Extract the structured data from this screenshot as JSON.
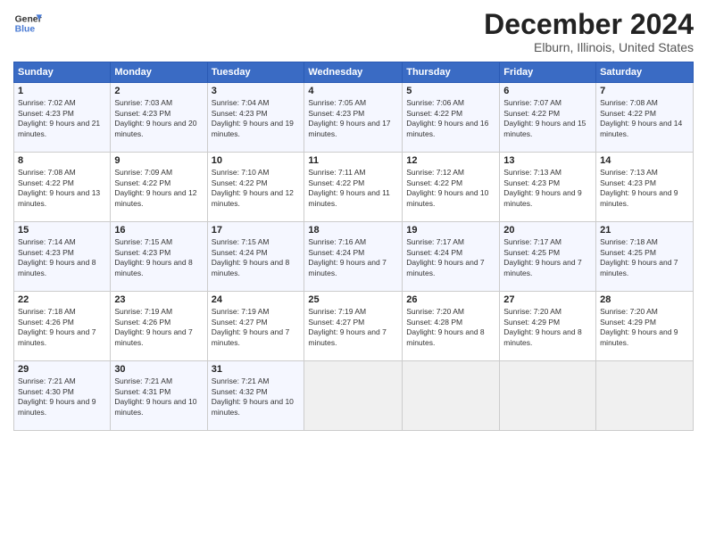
{
  "header": {
    "logo_line1": "General",
    "logo_line2": "Blue",
    "month": "December 2024",
    "location": "Elburn, Illinois, United States"
  },
  "weekdays": [
    "Sunday",
    "Monday",
    "Tuesday",
    "Wednesday",
    "Thursday",
    "Friday",
    "Saturday"
  ],
  "weeks": [
    [
      {
        "day": "1",
        "sunrise": "Sunrise: 7:02 AM",
        "sunset": "Sunset: 4:23 PM",
        "daylight": "Daylight: 9 hours and 21 minutes."
      },
      {
        "day": "2",
        "sunrise": "Sunrise: 7:03 AM",
        "sunset": "Sunset: 4:23 PM",
        "daylight": "Daylight: 9 hours and 20 minutes."
      },
      {
        "day": "3",
        "sunrise": "Sunrise: 7:04 AM",
        "sunset": "Sunset: 4:23 PM",
        "daylight": "Daylight: 9 hours and 19 minutes."
      },
      {
        "day": "4",
        "sunrise": "Sunrise: 7:05 AM",
        "sunset": "Sunset: 4:23 PM",
        "daylight": "Daylight: 9 hours and 17 minutes."
      },
      {
        "day": "5",
        "sunrise": "Sunrise: 7:06 AM",
        "sunset": "Sunset: 4:22 PM",
        "daylight": "Daylight: 9 hours and 16 minutes."
      },
      {
        "day": "6",
        "sunrise": "Sunrise: 7:07 AM",
        "sunset": "Sunset: 4:22 PM",
        "daylight": "Daylight: 9 hours and 15 minutes."
      },
      {
        "day": "7",
        "sunrise": "Sunrise: 7:08 AM",
        "sunset": "Sunset: 4:22 PM",
        "daylight": "Daylight: 9 hours and 14 minutes."
      }
    ],
    [
      {
        "day": "8",
        "sunrise": "Sunrise: 7:08 AM",
        "sunset": "Sunset: 4:22 PM",
        "daylight": "Daylight: 9 hours and 13 minutes."
      },
      {
        "day": "9",
        "sunrise": "Sunrise: 7:09 AM",
        "sunset": "Sunset: 4:22 PM",
        "daylight": "Daylight: 9 hours and 12 minutes."
      },
      {
        "day": "10",
        "sunrise": "Sunrise: 7:10 AM",
        "sunset": "Sunset: 4:22 PM",
        "daylight": "Daylight: 9 hours and 12 minutes."
      },
      {
        "day": "11",
        "sunrise": "Sunrise: 7:11 AM",
        "sunset": "Sunset: 4:22 PM",
        "daylight": "Daylight: 9 hours and 11 minutes."
      },
      {
        "day": "12",
        "sunrise": "Sunrise: 7:12 AM",
        "sunset": "Sunset: 4:22 PM",
        "daylight": "Daylight: 9 hours and 10 minutes."
      },
      {
        "day": "13",
        "sunrise": "Sunrise: 7:13 AM",
        "sunset": "Sunset: 4:23 PM",
        "daylight": "Daylight: 9 hours and 9 minutes."
      },
      {
        "day": "14",
        "sunrise": "Sunrise: 7:13 AM",
        "sunset": "Sunset: 4:23 PM",
        "daylight": "Daylight: 9 hours and 9 minutes."
      }
    ],
    [
      {
        "day": "15",
        "sunrise": "Sunrise: 7:14 AM",
        "sunset": "Sunset: 4:23 PM",
        "daylight": "Daylight: 9 hours and 8 minutes."
      },
      {
        "day": "16",
        "sunrise": "Sunrise: 7:15 AM",
        "sunset": "Sunset: 4:23 PM",
        "daylight": "Daylight: 9 hours and 8 minutes."
      },
      {
        "day": "17",
        "sunrise": "Sunrise: 7:15 AM",
        "sunset": "Sunset: 4:24 PM",
        "daylight": "Daylight: 9 hours and 8 minutes."
      },
      {
        "day": "18",
        "sunrise": "Sunrise: 7:16 AM",
        "sunset": "Sunset: 4:24 PM",
        "daylight": "Daylight: 9 hours and 7 minutes."
      },
      {
        "day": "19",
        "sunrise": "Sunrise: 7:17 AM",
        "sunset": "Sunset: 4:24 PM",
        "daylight": "Daylight: 9 hours and 7 minutes."
      },
      {
        "day": "20",
        "sunrise": "Sunrise: 7:17 AM",
        "sunset": "Sunset: 4:25 PM",
        "daylight": "Daylight: 9 hours and 7 minutes."
      },
      {
        "day": "21",
        "sunrise": "Sunrise: 7:18 AM",
        "sunset": "Sunset: 4:25 PM",
        "daylight": "Daylight: 9 hours and 7 minutes."
      }
    ],
    [
      {
        "day": "22",
        "sunrise": "Sunrise: 7:18 AM",
        "sunset": "Sunset: 4:26 PM",
        "daylight": "Daylight: 9 hours and 7 minutes."
      },
      {
        "day": "23",
        "sunrise": "Sunrise: 7:19 AM",
        "sunset": "Sunset: 4:26 PM",
        "daylight": "Daylight: 9 hours and 7 minutes."
      },
      {
        "day": "24",
        "sunrise": "Sunrise: 7:19 AM",
        "sunset": "Sunset: 4:27 PM",
        "daylight": "Daylight: 9 hours and 7 minutes."
      },
      {
        "day": "25",
        "sunrise": "Sunrise: 7:19 AM",
        "sunset": "Sunset: 4:27 PM",
        "daylight": "Daylight: 9 hours and 7 minutes."
      },
      {
        "day": "26",
        "sunrise": "Sunrise: 7:20 AM",
        "sunset": "Sunset: 4:28 PM",
        "daylight": "Daylight: 9 hours and 8 minutes."
      },
      {
        "day": "27",
        "sunrise": "Sunrise: 7:20 AM",
        "sunset": "Sunset: 4:29 PM",
        "daylight": "Daylight: 9 hours and 8 minutes."
      },
      {
        "day": "28",
        "sunrise": "Sunrise: 7:20 AM",
        "sunset": "Sunset: 4:29 PM",
        "daylight": "Daylight: 9 hours and 9 minutes."
      }
    ],
    [
      {
        "day": "29",
        "sunrise": "Sunrise: 7:21 AM",
        "sunset": "Sunset: 4:30 PM",
        "daylight": "Daylight: 9 hours and 9 minutes."
      },
      {
        "day": "30",
        "sunrise": "Sunrise: 7:21 AM",
        "sunset": "Sunset: 4:31 PM",
        "daylight": "Daylight: 9 hours and 10 minutes."
      },
      {
        "day": "31",
        "sunrise": "Sunrise: 7:21 AM",
        "sunset": "Sunset: 4:32 PM",
        "daylight": "Daylight: 9 hours and 10 minutes."
      },
      null,
      null,
      null,
      null
    ]
  ]
}
